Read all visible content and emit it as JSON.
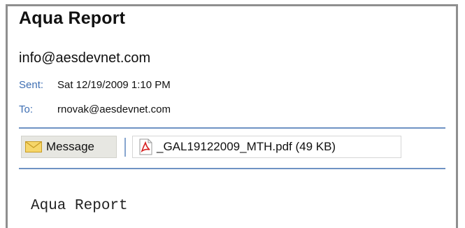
{
  "email": {
    "subject": "Aqua Report",
    "from": "info@aesdevnet.com",
    "sent_label": "Sent:",
    "sent_value": "Sat 12/19/2009 1:10 PM",
    "to_label": "To:",
    "to_value": "rnovak@aesdevnet.com"
  },
  "attachments": {
    "message_tab_label": "Message",
    "message_icon": "envelope-icon",
    "file_label": "_GAL19122009_MTH.pdf (49 KB)",
    "file_icon": "pdf-icon"
  },
  "body": {
    "text": "Aqua Report"
  },
  "colors": {
    "label_blue": "#3f6fb3",
    "rule_blue": "#6f93c4",
    "tab_bg": "#e7e7e2"
  }
}
